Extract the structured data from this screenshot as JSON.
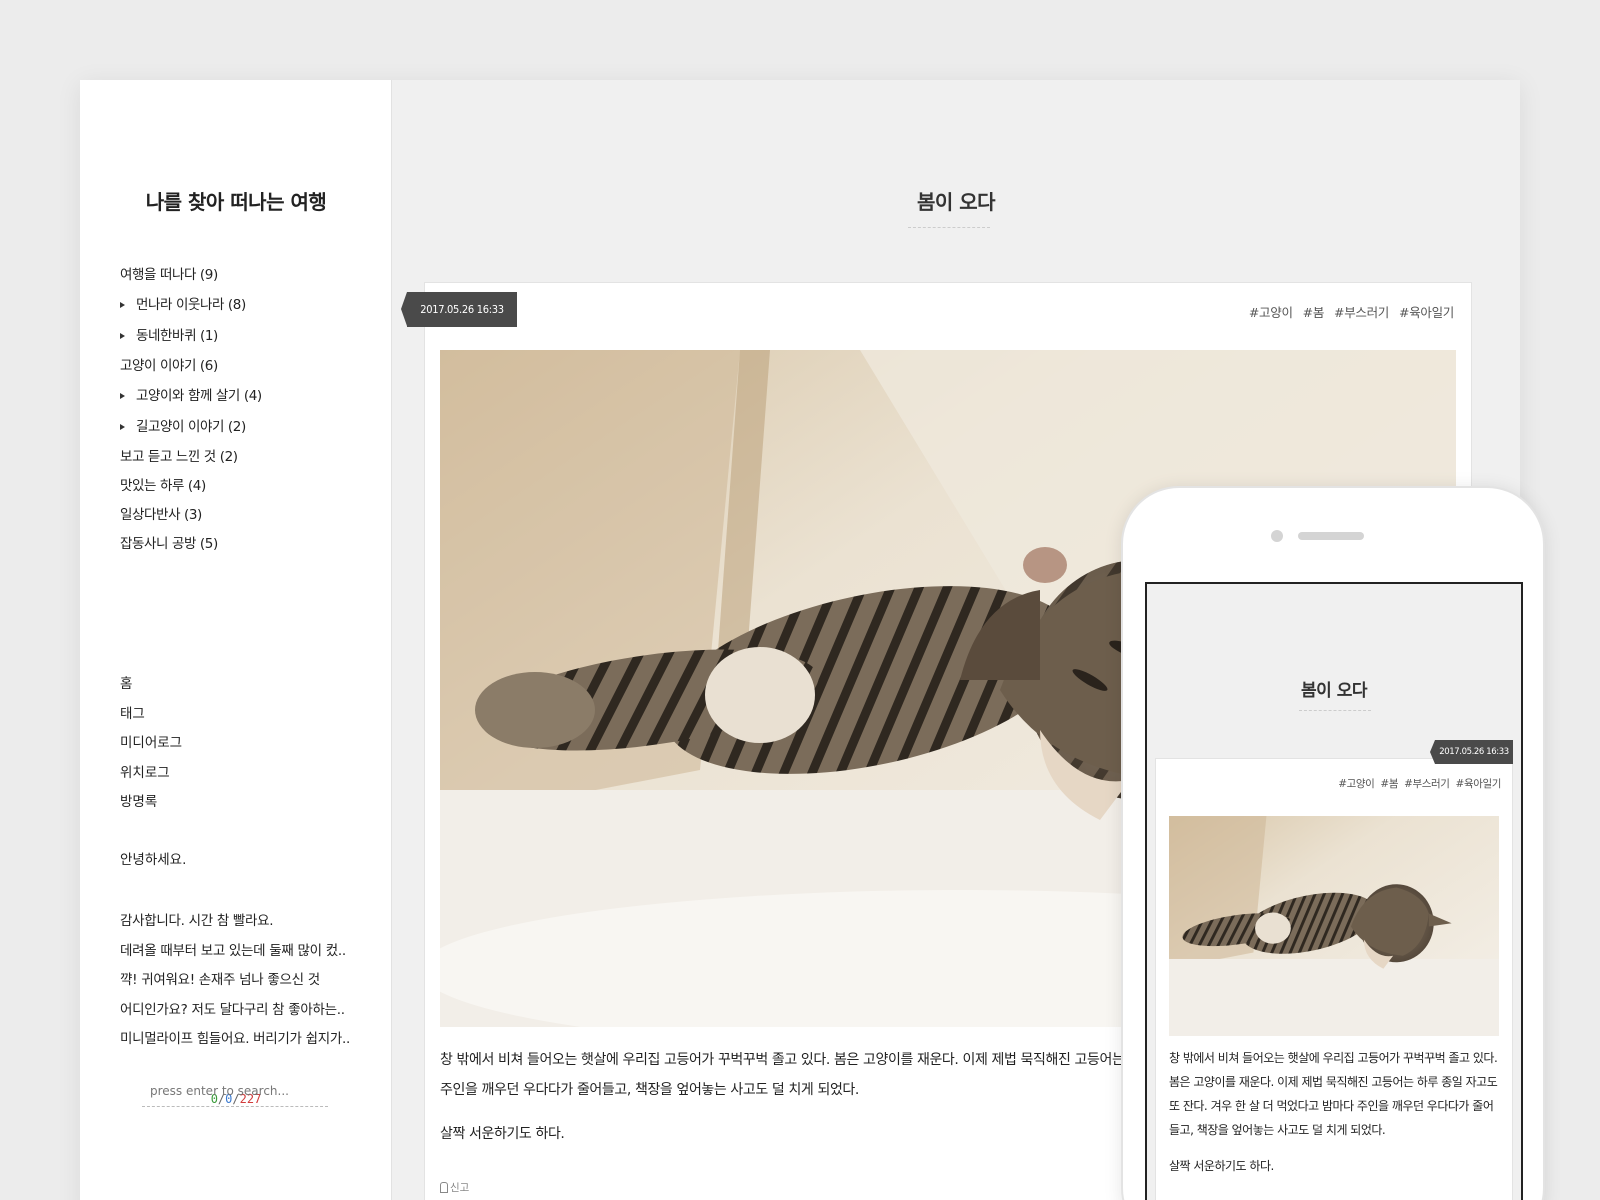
{
  "sidebar": {
    "blog_title": "나를 찾아 떠나는 여행",
    "categories": [
      {
        "label": "여행을 떠나다 (9)",
        "level": 0
      },
      {
        "label": "먼나라 이웃나라 (8)",
        "level": 1
      },
      {
        "label": "동네한바퀴 (1)",
        "level": 1
      },
      {
        "label": "고양이 이야기 (6)",
        "level": 0
      },
      {
        "label": "고양이와 함께 살기 (4)",
        "level": 1
      },
      {
        "label": "길고양이 이야기 (2)",
        "level": 1
      },
      {
        "label": "보고 듣고 느낀 것 (2)",
        "level": 0
      },
      {
        "label": "맛있는 하루 (4)",
        "level": 0
      },
      {
        "label": "일상다반사 (3)",
        "level": 0
      },
      {
        "label": "잡동사니 공방 (5)",
        "level": 0
      }
    ],
    "nav": [
      "홈",
      "태그",
      "미디어로그",
      "위치로그",
      "방명록"
    ],
    "notice": "안녕하세요.",
    "recent_comments": [
      "감사합니다. 시간 참 빨라요.",
      "데려올 때부터 보고 있는데 둘째 많이 컸..",
      "꺅! 귀여워요! 손재주 넘나 좋으신 것",
      "어디인가요? 저도 달다구리 참 좋아하는..",
      "미니멀라이프 힘들어요. 버리기가 쉽지가.."
    ],
    "counter": {
      "today": "0",
      "yesterday": "0",
      "total": "227",
      "separator": "/"
    },
    "search_placeholder": "press enter to search..."
  },
  "post": {
    "title": "봄이 오다",
    "date": "2017.05.26 16:33",
    "tags": [
      "#고양이",
      "#봄",
      "#부스러기",
      "#육아일기"
    ],
    "paragraph1": "창 밖에서 비쳐 들어오는 햇살에 우리집 고등어가 꾸벅꾸벅 졸고 있다. 봄은 고양이를 재운다. 이제 제법 묵직해진 고등어는 하루 종일 자고도 또 잔다. 겨우 한 살 더 먹었다고 밤마다 주인을 깨우던 우다다가 줄어들고, 책장을 엎어놓는 사고도 덜 치게 되었다.",
    "paragraph2": "살짝 서운하기도 하다.",
    "report_label": "신고"
  },
  "mobile": {
    "title": "봄이 오다",
    "date": "2017.05.26 16:33",
    "tags": [
      "#고양이",
      "#봄",
      "#부스러기",
      "#육아일기"
    ],
    "paragraph1": "창 밖에서 비쳐 들어오는 햇살에 우리집 고등어가 꾸벅꾸벅 졸고 있다. 봄은 고양이를 재운다. 이제 제법 묵직해진 고등어는 하루 종일 자고도 또 잔다. 겨우 한 살 더 먹었다고 밤마다 주인을 깨우던 우다다가 줄어들고, 책장을 엎어놓는 사고도 덜 치게 되었다.",
    "paragraph2": "살짝 서운하기도 하다."
  },
  "colors": {
    "counter_today": "#3a9b3a",
    "counter_yesterday": "#3b7ad0",
    "counter_total": "#d23b3b",
    "date_ribbon": "#4a4a4a"
  }
}
